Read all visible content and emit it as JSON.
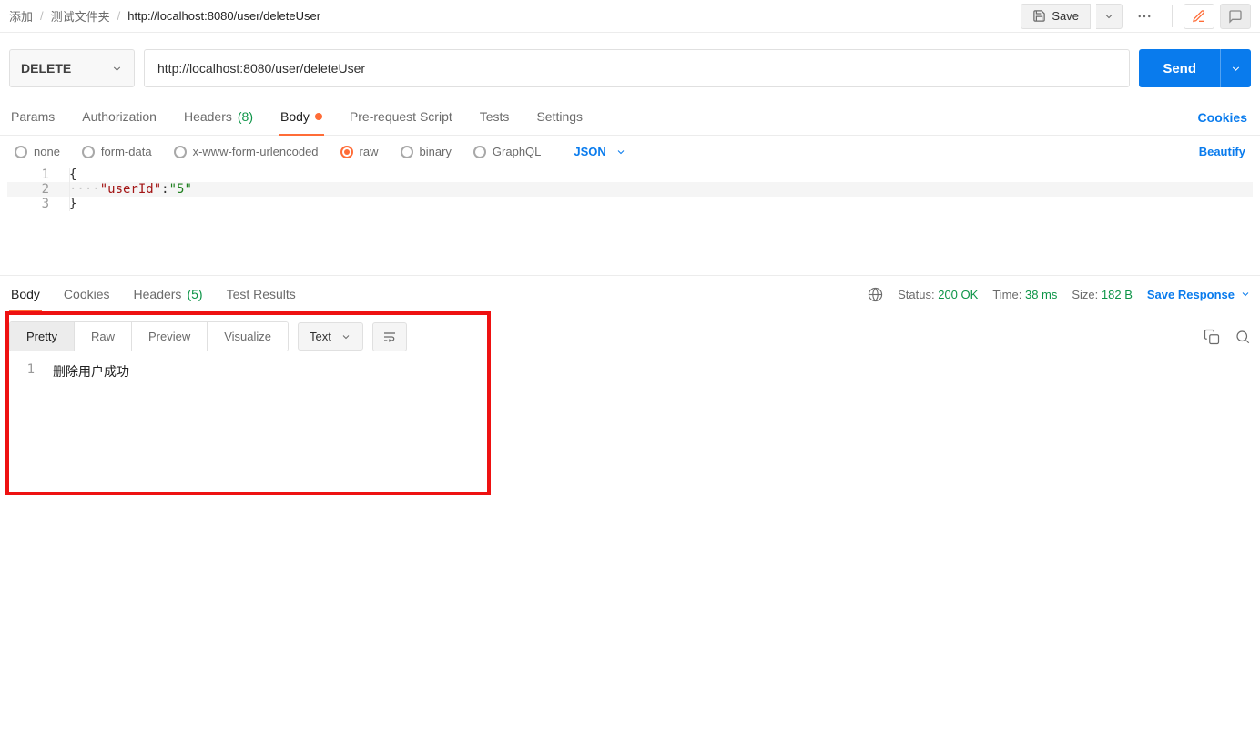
{
  "breadcrumb": {
    "root": "添加",
    "folder": "测试文件夹",
    "current": "http://localhost:8080/user/deleteUser"
  },
  "topbar": {
    "save": "Save"
  },
  "request": {
    "method": "DELETE",
    "url": "http://localhost:8080/user/deleteUser",
    "send": "Send"
  },
  "tabs": {
    "params": "Params",
    "authorization": "Authorization",
    "headers": "Headers",
    "headers_count": "(8)",
    "body": "Body",
    "prerequest": "Pre-request Script",
    "tests": "Tests",
    "settings": "Settings",
    "cookies": "Cookies"
  },
  "body_types": {
    "none": "none",
    "form_data": "form-data",
    "urlencoded": "x-www-form-urlencoded",
    "raw": "raw",
    "binary": "binary",
    "graphql": "GraphQL",
    "format": "JSON",
    "beautify": "Beautify"
  },
  "editor": {
    "ln1": "1",
    "ln2": "2",
    "ln3": "3",
    "brace_open": "{",
    "key": "\"userId\"",
    "colon": ":",
    "value": "\"5\"",
    "brace_close": "}",
    "indent": "····"
  },
  "response": {
    "tabs": {
      "body": "Body",
      "cookies": "Cookies",
      "headers": "Headers",
      "headers_count": "(5)",
      "test_results": "Test Results"
    },
    "meta": {
      "status_label": "Status:",
      "status_value": "200 OK",
      "time_label": "Time:",
      "time_value": "38 ms",
      "size_label": "Size:",
      "size_value": "182 B",
      "save": "Save Response"
    },
    "view": {
      "pretty": "Pretty",
      "raw": "Raw",
      "preview": "Preview",
      "visualize": "Visualize",
      "text": "Text"
    },
    "body_ln": "1",
    "body_text": "删除用户成功"
  }
}
